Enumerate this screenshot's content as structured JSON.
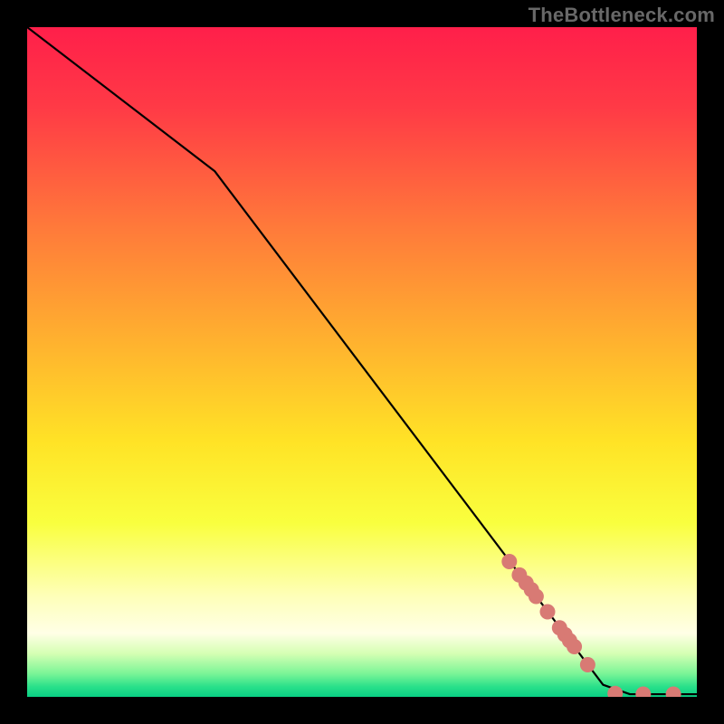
{
  "watermark": "TheBottleneck.com",
  "chart_data": {
    "type": "line",
    "title": "",
    "xlabel": "",
    "ylabel": "",
    "xlim": [
      0,
      100
    ],
    "ylim": [
      0,
      100
    ],
    "grid": false,
    "series": [
      {
        "name": "curve",
        "points": [
          {
            "x": 0,
            "y": 100
          },
          {
            "x": 28,
            "y": 78.5
          },
          {
            "x": 86,
            "y": 1.8
          },
          {
            "x": 90,
            "y": 0.4
          },
          {
            "x": 100,
            "y": 0.4
          }
        ]
      }
    ],
    "markers": {
      "name": "highlight-dots",
      "color": "#d87a74",
      "radius_px": 8.5,
      "points": [
        {
          "x": 72.0,
          "y": 20.2
        },
        {
          "x": 73.5,
          "y": 18.2
        },
        {
          "x": 74.5,
          "y": 17.0
        },
        {
          "x": 75.3,
          "y": 16.0
        },
        {
          "x": 76.0,
          "y": 15.0
        },
        {
          "x": 77.7,
          "y": 12.7
        },
        {
          "x": 79.5,
          "y": 10.3
        },
        {
          "x": 80.3,
          "y": 9.3
        },
        {
          "x": 81.0,
          "y": 8.4
        },
        {
          "x": 81.7,
          "y": 7.5
        },
        {
          "x": 83.7,
          "y": 4.8
        },
        {
          "x": 87.8,
          "y": 0.5
        },
        {
          "x": 92.0,
          "y": 0.4
        },
        {
          "x": 96.5,
          "y": 0.4
        }
      ]
    },
    "gradient_stops": [
      {
        "offset": 0.0,
        "color": "#ff1f4a"
      },
      {
        "offset": 0.12,
        "color": "#ff3a46"
      },
      {
        "offset": 0.3,
        "color": "#ff7a3a"
      },
      {
        "offset": 0.48,
        "color": "#ffb52e"
      },
      {
        "offset": 0.62,
        "color": "#ffe326"
      },
      {
        "offset": 0.74,
        "color": "#f9ff3e"
      },
      {
        "offset": 0.85,
        "color": "#feffb9"
      },
      {
        "offset": 0.905,
        "color": "#ffffe6"
      },
      {
        "offset": 0.935,
        "color": "#d6ffb4"
      },
      {
        "offset": 0.965,
        "color": "#7cf597"
      },
      {
        "offset": 0.985,
        "color": "#29e08a"
      },
      {
        "offset": 1.0,
        "color": "#09cf84"
      }
    ]
  }
}
